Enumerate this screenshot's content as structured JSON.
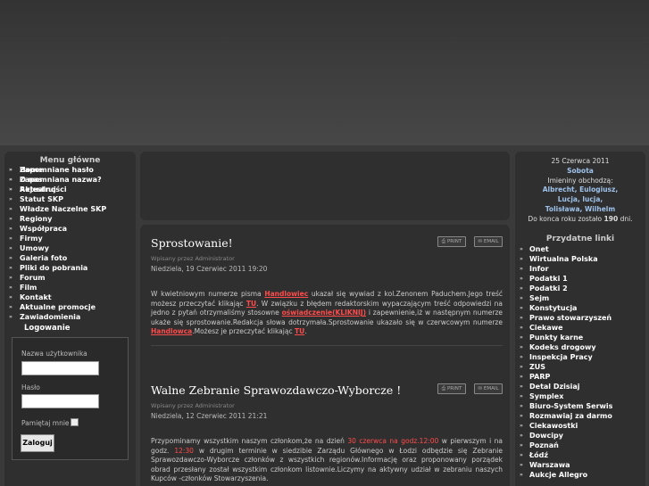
{
  "left": {
    "menu_title": "Menu główne",
    "menu": [
      "Home",
      "O nas",
      "Aktualności",
      "Statut SKP",
      "Władze Naczelne SKP",
      "Regiony",
      "Współpraca",
      "Firmy",
      "Umowy",
      "Galeria foto",
      "Pliki do pobrania",
      "Forum",
      "Film",
      "Kontakt",
      "Aktualne promocje",
      "Zawiadomienia"
    ],
    "login_title": "Logowanie",
    "login": {
      "username_label": "Nazwa użytkownika",
      "password_label": "Hasło",
      "remember_label": "Pamiętaj mnie",
      "submit": "Zaloguj"
    },
    "login_links": [
      "Zapomniane hasło",
      "Zapomniana nazwa?",
      "Rejestruj"
    ]
  },
  "articles": [
    {
      "title": "Sprostowanie!",
      "author": "Wpisany przez Administrator",
      "date": "Niedziela, 19 Czerwiec 2011 19:20",
      "p1": "W kwietniowym numerze pisma ",
      "l1": "Handlowiec",
      "p2": " ukazał się wywiad z kol.Zenonem Paduchem.Jego treść możesz przeczytać klikając ",
      "l2": "TU",
      "p3": ". W związku z błędem redaktorskim wypaczającym treść odpowiedzi na jedno z pytań otrzymaliśmy stosowne ",
      "l3": "oświadczenie(KLIKNIJ)",
      "p4": " i zapewnienie,iż w następnym numerze ukaże się sprostowanie.Redakcja słowa dotrzymała.Sprostowanie ukazało się w czerwcowym numerze ",
      "l4": "Handlowca",
      "p5": ".Możesz je przeczytać klikając ",
      "l5": "TU",
      "p6": "."
    },
    {
      "title": "Walne Zebranie Sprawozdawczo-Wyborcze !",
      "author": "Wpisany przez Administrator",
      "date": "Niedziela, 12 Czerwiec 2011 21:21",
      "p1": "Przypominamy wszystkim naszym członkom,że na dzień ",
      "s1": "30 czerwca na godz.12:00",
      "p2": " w pierwszym i na godz. ",
      "s2": "12:30",
      "p3": " w drugim terminie w siedzibie Zarządu Głównego w Łodzi odbędzie się Zebranie Sprawozdawczo-Wyborcze członków z wszystkich regionów.Informację oraz proponowany porządek obrad przesłany został wszystkim członkom listownie.Liczymy na aktywny udział w zebraniu naszych Kupców -członków Stowarzyszenia."
    }
  ],
  "article_buttons": {
    "print": "PRINT",
    "email": "EMAIL"
  },
  "right": {
    "date": "25 Czerwca 2011",
    "day": "Sobota",
    "names_label": "Imieniny obchodzą:",
    "names1": "Albrecht, Eulogiusz,",
    "names2": "Lucja, lucja,",
    "names3": "Tolisława, Wilhelm",
    "remain_prefix": "Do konca roku zostało ",
    "remain_days": "190",
    "remain_suffix": " dni.",
    "links_title": "Przydatne linki",
    "links": [
      "Onet",
      "Wirtualna Polska",
      "Infor",
      "Podatki 1",
      "Podatki 2",
      "Sejm",
      "Konstytucja",
      "Prawo stowarzyszeń",
      "Ciekawe",
      "Punkty karne",
      "Kodeks drogowy",
      "Inspekcja Pracy",
      "ZUS",
      "PARP",
      "Detal Dzisiaj",
      "Symplex",
      "Biuro-System Serwis",
      "Rozmawiaj za darmo",
      "Ciekawostki",
      "Dowcipy",
      "Poznań",
      "Łódź",
      "Warszawa",
      "Aukcje Allegro"
    ]
  },
  "colors": {
    "link_red": "#ff4b4b",
    "accent_blue": "#9ec2ea",
    "panel": "#2f2f2f",
    "background": "#3a3a3a"
  }
}
